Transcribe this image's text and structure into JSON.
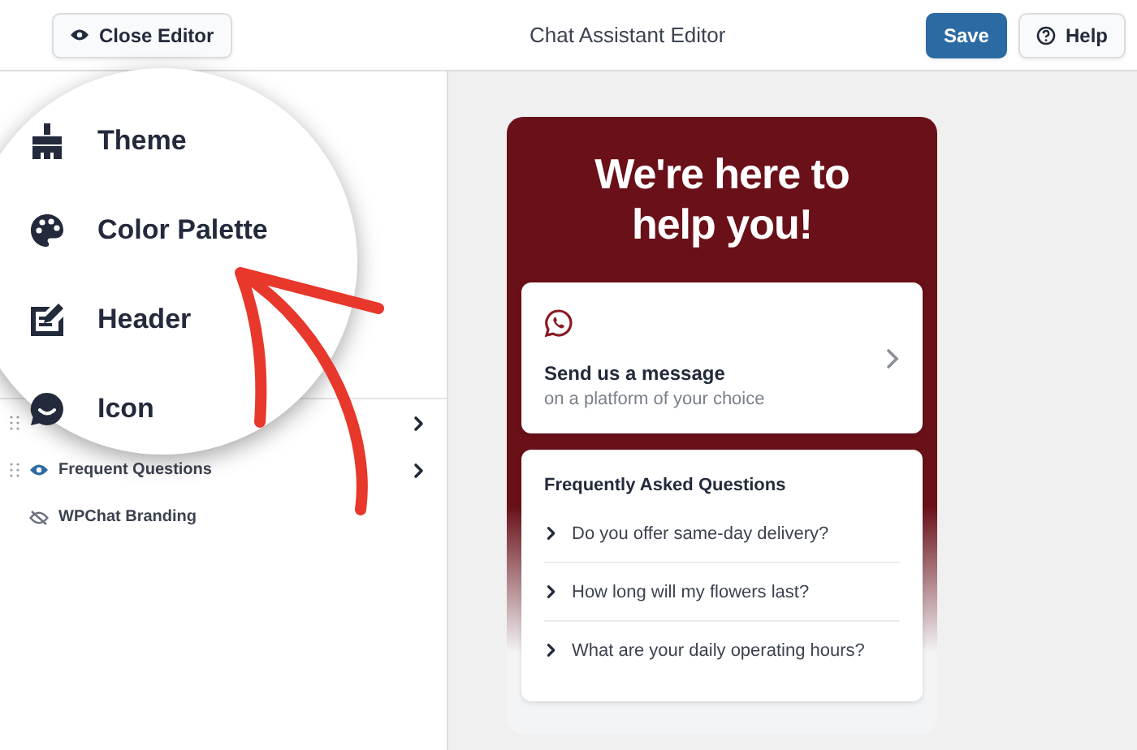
{
  "top_bar": {
    "close_button": "Close Editor",
    "title": "Chat Assistant Editor",
    "save_button": "Save",
    "help_button": "Help"
  },
  "sidebar": {
    "items": [
      {
        "draggable": true,
        "expandable": true
      },
      {
        "label": "Frequent Questions",
        "draggable": true,
        "expandable": true,
        "visible": true
      },
      {
        "label": "WPChat Branding",
        "draggable": false,
        "expandable": false,
        "visible": false
      }
    ]
  },
  "magnifier": {
    "items": [
      {
        "kind": "theme",
        "label": "Theme"
      },
      {
        "kind": "palette",
        "label": "Color Palette"
      },
      {
        "kind": "header",
        "label": "Header"
      },
      {
        "kind": "icon",
        "label": "Icon"
      }
    ]
  },
  "preview": {
    "heading": "We're here to help you!",
    "message_card": {
      "title": "Send us a message",
      "subtitle": "on a platform of your choice"
    },
    "faq": {
      "title": "Frequently Asked Questions",
      "questions": [
        "Do you offer same-day delivery?",
        "How long will my flowers last?",
        "What are your daily operating hours?"
      ]
    }
  }
}
